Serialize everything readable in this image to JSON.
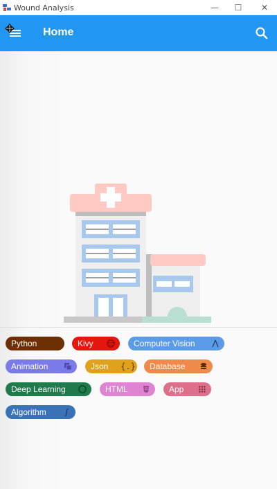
{
  "window": {
    "title": "Wound Analysis",
    "minimize_glyph": "—",
    "maximize_glyph": "☐",
    "close_glyph": "✕"
  },
  "appbar": {
    "title": "Home",
    "menu_icon": "menu-icon",
    "search_icon": "search-icon"
  },
  "chips": [
    {
      "label": "Python",
      "color": "#6d2e02",
      "icon": null
    },
    {
      "label": "Kivy",
      "color": "#e5160e",
      "icon": "ball-icon"
    },
    {
      "label": "Computer Vision",
      "color": "#5b9be8",
      "icon": "compass-icon"
    },
    {
      "label": "Animation",
      "color": "#7a7ae8",
      "icon": "copy-icon"
    },
    {
      "label": "Json",
      "color": "#e0a21c",
      "icon": "braces-icon"
    },
    {
      "label": "Database",
      "color": "#f0894a",
      "icon": "database-icon"
    },
    {
      "label": "Deep Learning",
      "color": "#1f7a4c",
      "icon": "neural-icon"
    },
    {
      "label": "HTML",
      "color": "#de84d2",
      "icon": "html5-icon"
    },
    {
      "label": "App",
      "color": "#de6f8c",
      "icon": "grid-icon"
    },
    {
      "label": "Algorithm",
      "color": "#3a72b8",
      "icon": "integral-icon"
    }
  ]
}
